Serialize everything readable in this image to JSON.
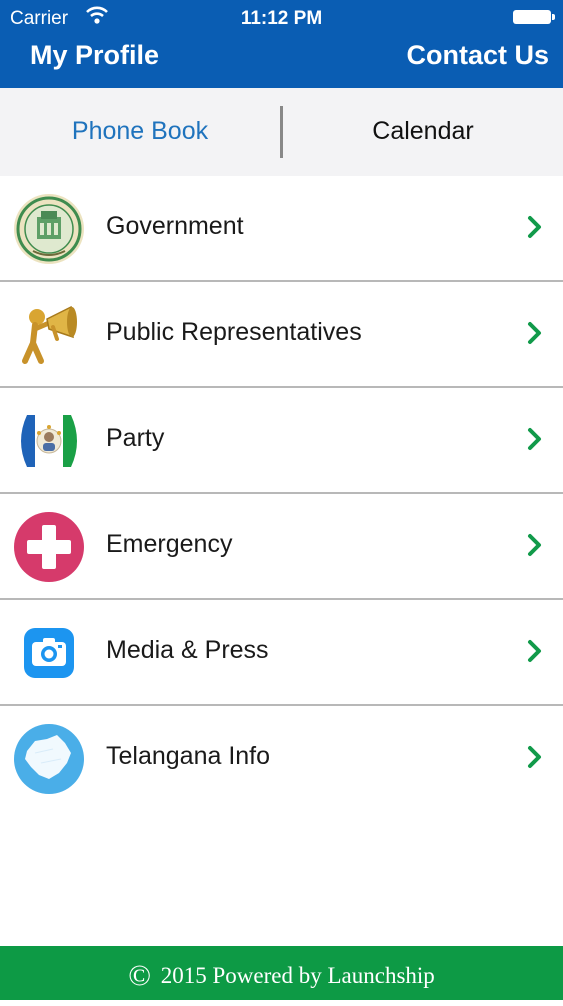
{
  "status_bar": {
    "carrier": "Carrier",
    "time": "11:12 PM"
  },
  "header": {
    "left_label": "My Profile",
    "right_label": "Contact Us",
    "bg_color": "#0a5db3"
  },
  "tabs": [
    {
      "label": "Phone Book",
      "active": true
    },
    {
      "label": "Calendar",
      "active": false
    }
  ],
  "list": [
    {
      "label": "Government",
      "icon": "government-emblem-icon"
    },
    {
      "label": "Public Representatives",
      "icon": "megaphone-figure-icon"
    },
    {
      "label": "Party",
      "icon": "party-flag-icon"
    },
    {
      "label": "Emergency",
      "icon": "emergency-cross-icon"
    },
    {
      "label": "Media & Press",
      "icon": "camera-icon"
    },
    {
      "label": "Telangana Info",
      "icon": "state-map-icon"
    }
  ],
  "footer": {
    "symbol": "©",
    "text": "2015 Powered by Launchship",
    "bg_color": "#0d9a45"
  },
  "colors": {
    "accent": "#1f73bd",
    "chevron": "#119a4a"
  }
}
